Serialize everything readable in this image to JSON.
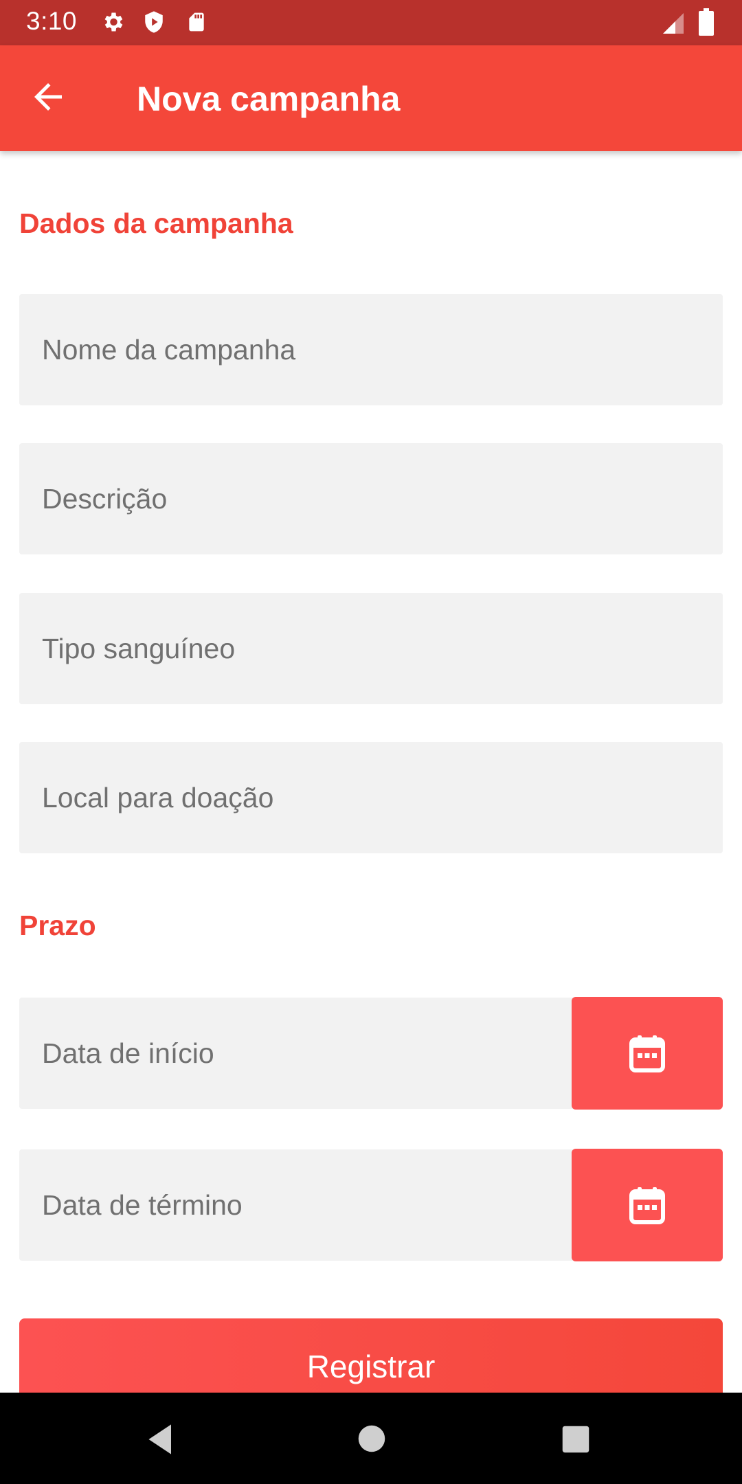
{
  "status_bar": {
    "time": "3:10",
    "icons": [
      "gear-icon",
      "shield-icon",
      "sd-card-icon",
      "signal-icon",
      "battery-icon"
    ]
  },
  "app_bar": {
    "title": "Nova campanha",
    "back_icon": "arrow-back-icon"
  },
  "form": {
    "section_campaign": "Dados da campanha",
    "name_placeholder": "Nome da campanha",
    "description_placeholder": "Descrição",
    "blood_type_placeholder": "Tipo sanguíneo",
    "location_placeholder": "Local para doação",
    "section_deadline": "Prazo",
    "start_date_placeholder": "Data de início",
    "end_date_placeholder": "Data de término",
    "calendar_icon": "calendar-icon",
    "register_label": "Registrar"
  },
  "nav_bar": {
    "icons": [
      "back-triangle-icon",
      "home-circle-icon",
      "recents-square-icon"
    ]
  },
  "colors": {
    "status_bar": "#b8312c",
    "app_bar": "#f4473a",
    "accent": "#f04338",
    "calendar_button": "#fc5252",
    "field_background": "#f2f2f2"
  }
}
